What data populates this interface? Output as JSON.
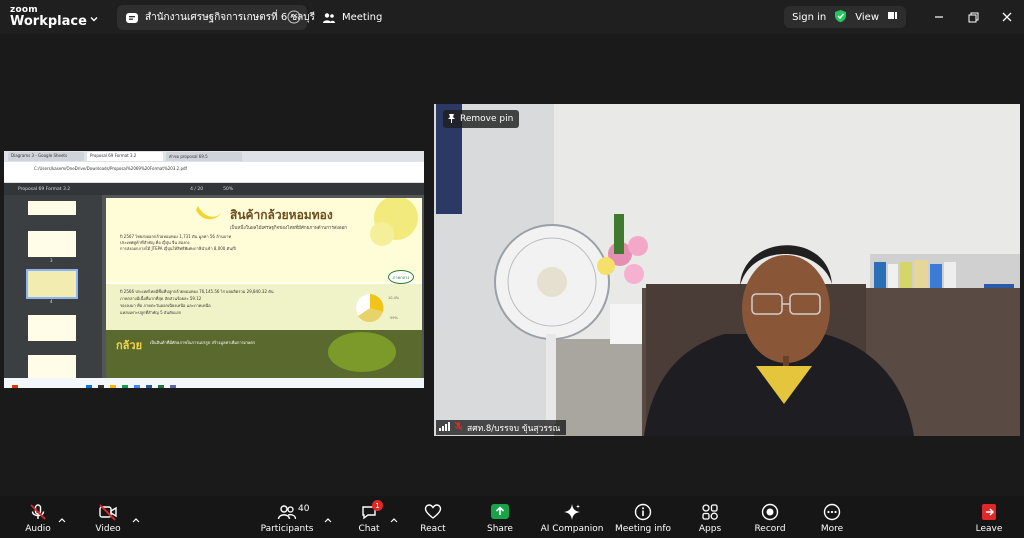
{
  "app": {
    "brand_top": "zoom",
    "brand_bottom": "Workplace"
  },
  "tabs": [
    {
      "label": "สำนักงานเศรษฐกิจการเกษตรที่ 6 ชลบุรี",
      "active": true
    },
    {
      "label": "Meeting",
      "active": false
    }
  ],
  "header": {
    "sign_in": "Sign in",
    "view": "View"
  },
  "pin_label": "Remove pin",
  "participant_name": "สศท.8/บรรจบ ขุ้นสุวรรณ",
  "shared_screen": {
    "browser_tabs": [
      "Diagrams 3 - Google Sheets",
      "Proposal 69 Format 3.2",
      "คำขอ proposal 69.5"
    ],
    "address": "C:/Users/kasem/OneDrive/Downloads/Proposal%2069%20Format%203.2.pdf",
    "pdf_title": "Proposal 69 Format 3.2",
    "page_indicator": "4 / 20",
    "zoom": "50%",
    "thumb_numbers": [
      "3",
      "4"
    ],
    "slide_title": "สินค้ากล้วยหอมทอง",
    "slide_subtitle": "เป็นหนึ่งในผลไม้เศรษฐกิจของไทยที่มีศักยภาพด้านการส่งออก",
    "bullets_top": [
      "ปี 2567 ไทยส่งออกกล้วยหอมทอง 1,731 ตัน มูลค่า 56 ล้านบาท",
      "ประเทศคู่ค้าที่สำคัญ คือ ญี่ปุ่น จีน ฮ่องกง",
      "การส่งออกภายใต้ JTEPA ญี่ปุ่นให้สิทธิพิเศษภาษีนำเข้า 8,000 ตัน/ปี"
    ],
    "bullets_bottom": [
      "ปี 2566 ประเทศไทยมีพื้นที่ปลูกกล้วยหอมทอง 76,145.56 ไร่ ผลผลิตรวม 29,840.32 ตัน",
      "ภาคกลางมีเนื้อที่มากที่สุด สัดส่วนร้อยละ 59.12",
      "รองลงมา คือ ภาคตะวันออกเฉียงเหนือ และภาคเหนือ",
      "แหล่งเพาะปลูกที่สำคัญ 5 อันดับแรก"
    ],
    "badge": "ภาคกลาง",
    "bottom_word": "กล้วย",
    "bottom_text": "เป็นสินค้าที่มีศักยภาพในการแปรรูป สร้างมูลค่าเพิ่มการเกษตร",
    "pie_labels": [
      "10.4%",
      "59%"
    ]
  },
  "toolbar": {
    "audio": "Audio",
    "video": "Video",
    "participants": "Participants",
    "participants_count": "40",
    "chat": "Chat",
    "chat_badge": "1",
    "react": "React",
    "share": "Share",
    "ai": "AI Companion",
    "meeting_info": "Meeting info",
    "apps": "Apps",
    "record": "Record",
    "more": "More",
    "leave": "Leave"
  },
  "colors": {
    "accent_green": "#16a34a",
    "leave_red": "#e02828",
    "shield_green": "#22c55e"
  }
}
